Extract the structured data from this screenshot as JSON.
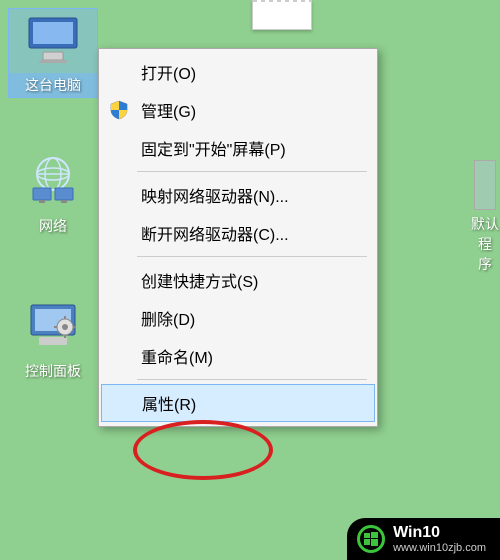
{
  "desktop": {
    "icons": [
      {
        "id": "this-pc",
        "label": "这台电脑",
        "selected": true
      },
      {
        "id": "network",
        "label": "网络",
        "selected": false
      },
      {
        "id": "control-panel",
        "label": "控制面板",
        "selected": false
      }
    ]
  },
  "partial_icon": {
    "label_line1": "默认程",
    "label_line2": "序"
  },
  "context_menu": {
    "items": [
      {
        "id": "open",
        "label": "打开(O)",
        "shield": false
      },
      {
        "id": "manage",
        "label": "管理(G)",
        "shield": true
      },
      {
        "id": "pin-start",
        "label": "固定到\"开始\"屏幕(P)",
        "shield": false
      },
      {
        "type": "sep"
      },
      {
        "id": "map-drive",
        "label": "映射网络驱动器(N)...",
        "shield": false
      },
      {
        "id": "disconnect-drive",
        "label": "断开网络驱动器(C)...",
        "shield": false
      },
      {
        "type": "sep"
      },
      {
        "id": "create-shortcut",
        "label": "创建快捷方式(S)",
        "shield": false
      },
      {
        "id": "delete",
        "label": "删除(D)",
        "shield": false
      },
      {
        "id": "rename",
        "label": "重命名(M)",
        "shield": false
      },
      {
        "type": "sep"
      },
      {
        "id": "properties",
        "label": "属性(R)",
        "shield": false,
        "highlighted": true
      }
    ]
  },
  "watermark": {
    "line1": "Win10",
    "line2": "www.win10zjb.com"
  }
}
